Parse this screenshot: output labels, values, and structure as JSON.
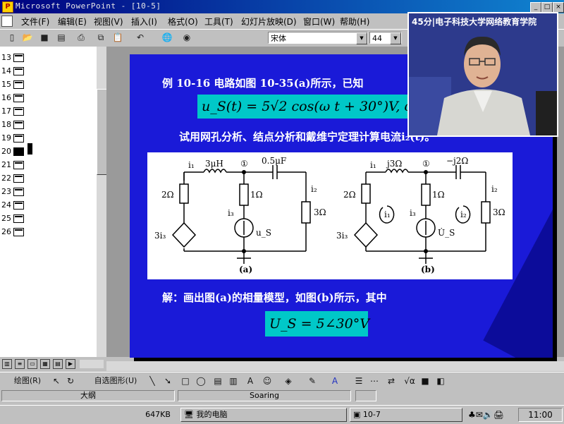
{
  "window": {
    "title": "Microsoft PowerPoint - [10-5]",
    "app_icon": "P",
    "buttons": [
      "_",
      "□",
      "×"
    ]
  },
  "menu": [
    "文件(F)",
    "编辑(E)",
    "视图(V)",
    "插入(I)",
    "格式(O)",
    "工具(T)",
    "幻灯片放映(D)",
    "窗口(W)",
    "帮助(H)"
  ],
  "toolbar": {
    "font_name": "宋体",
    "font_size": "44",
    "icons": [
      "new-icon",
      "open-icon",
      "save-icon",
      "print-preview-icon",
      "print-icon",
      "copy-icon",
      "paste-icon",
      "undo-icon",
      "hyperlink-icon",
      "web-icon"
    ]
  },
  "outline": {
    "slides": [
      "13",
      "14",
      "15",
      "16",
      "17",
      "18",
      "19",
      "20",
      "21",
      "22",
      "23",
      "24",
      "25",
      "26"
    ],
    "selected": "20"
  },
  "slide": {
    "line1": "例 10-16  电路如图 10-35(a)所示，已知",
    "formula1": "u_S(t) = 5√2 cos(ω t + 30°)V, ω =",
    "line2": "试用网孔分析、结点分析和戴维宁定理计算电流i₂(t)。",
    "solution": "解：画出图(a)的相量模型，如图(b)所示，其中",
    "formula2": "U_S = 5∠30°V"
  },
  "circuit": {
    "a": {
      "i1": "i₁",
      "L": "3μH",
      "node": "①",
      "C": "0.5μF",
      "R1": "2Ω",
      "R2": "1Ω",
      "R3": "3Ω",
      "i2": "i₂",
      "i3": "i₃",
      "src": "3i₃",
      "us": "u_S",
      "caption": "(a)"
    },
    "b": {
      "i1": "i₁",
      "L": "j3Ω",
      "node": "①",
      "C": "−j2Ω",
      "R1": "2Ω",
      "R2": "1Ω",
      "R3": "3Ω",
      "i2": "i₂",
      "i3": "i₃",
      "src": "3i₃",
      "us": "U̇_S",
      "mesh1": "i₁",
      "mesh2": "i₂",
      "caption": "(b)"
    }
  },
  "video": {
    "caption": "45分|电子科技大学网络教育学院"
  },
  "drawbar": {
    "draw_label": "绘图(R)",
    "autoshape_label": "自选图形(U)"
  },
  "status": {
    "left": "大纲",
    "mid": "Soaring"
  },
  "taskbar": {
    "size": "647KB",
    "computer": "我的电脑",
    "window": "10-7",
    "clock": "11:00"
  }
}
